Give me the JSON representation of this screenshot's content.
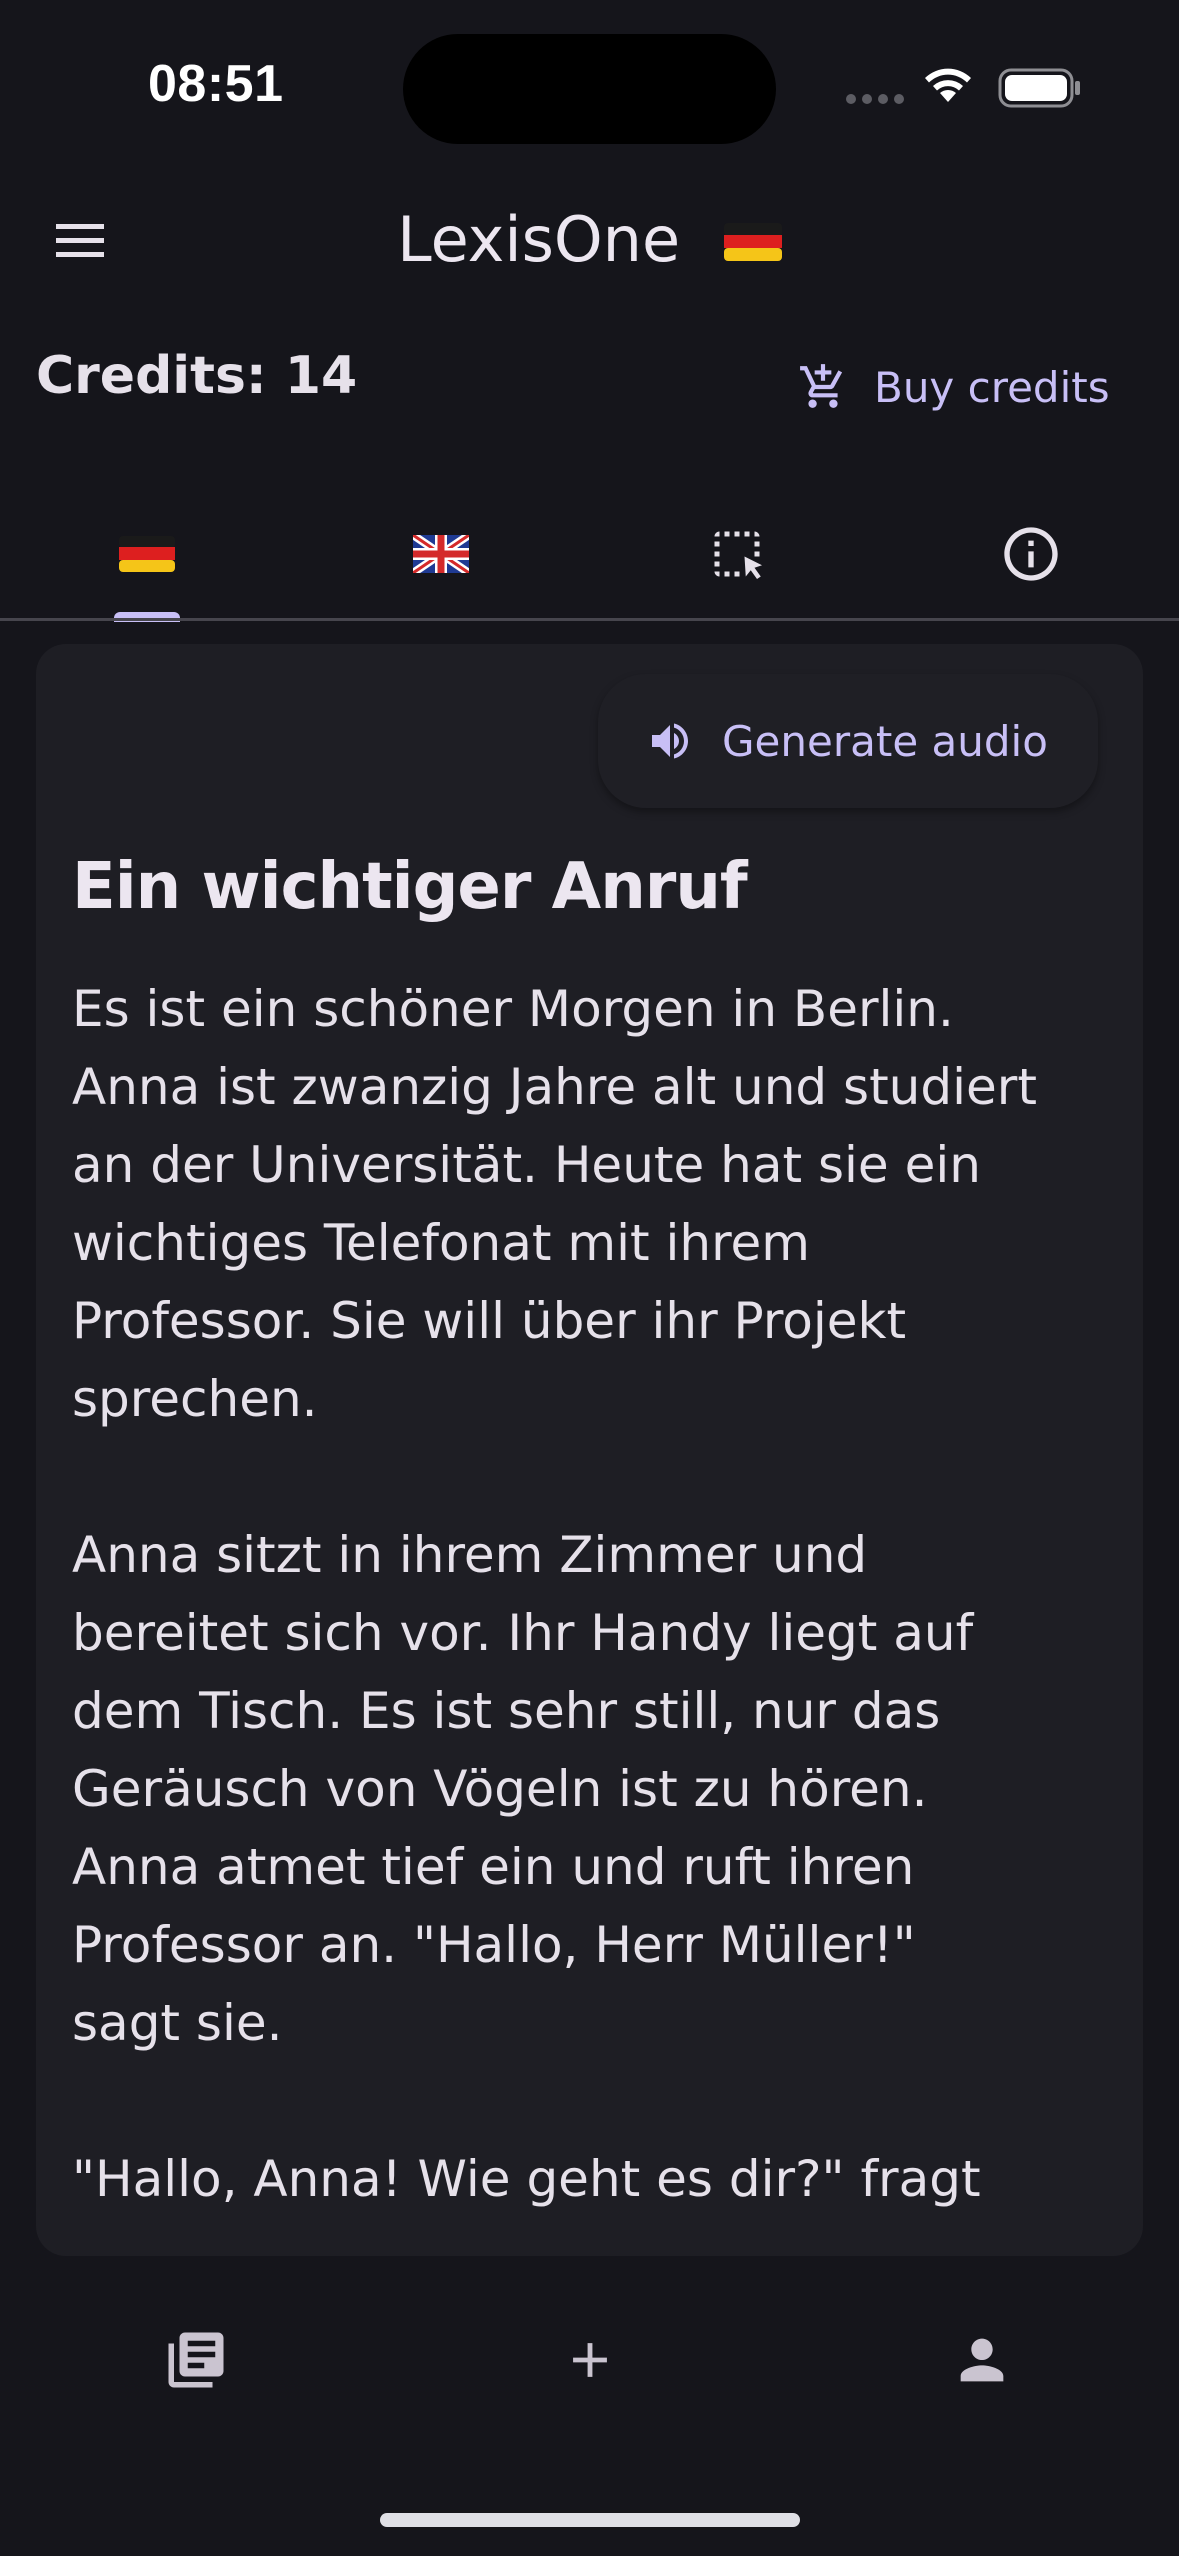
{
  "status_bar": {
    "time": "08:51"
  },
  "app_bar": {
    "title": "LexisOne",
    "language_flag": "german-flag-icon"
  },
  "credits": {
    "label": "Credits: 14",
    "buy_label": "Buy credits"
  },
  "tabs": [
    {
      "icon": "german-flag-icon",
      "selected": true
    },
    {
      "icon": "uk-flag-icon",
      "selected": false
    },
    {
      "icon": "select-area-icon",
      "selected": false
    },
    {
      "icon": "info-icon",
      "selected": false
    }
  ],
  "story": {
    "audio_button_label": "Generate audio",
    "title": "Ein wichtiger Anruf",
    "body": "Es ist ein schöner Morgen in Berlin.\nAnna ist zwanzig Jahre alt und studiert\nan der Universität. Heute hat sie ein\nwichtiges Telefonat mit ihrem\nProfessor. Sie will über ihr Projekt\nsprechen.\n\nAnna sitzt in ihrem Zimmer und\nbereitet sich vor. Ihr Handy liegt auf\ndem Tisch. Es ist sehr still, nur das\nGeräusch von Vögeln ist zu hören.\nAnna atmet tief ein und ruft ihren\nProfessor an. \"Hallo, Herr Müller!\"\nsagt sie.\n\n\"Hallo, Anna! Wie geht es dir?\" fragt"
  },
  "bottom_nav": [
    {
      "icon": "library-icon"
    },
    {
      "icon": "add-icon"
    },
    {
      "icon": "account-icon"
    }
  ],
  "colors": {
    "background": "#15151b",
    "card": "#1e1e24",
    "accent": "#c8bff6",
    "text": "#e6e1ea"
  }
}
